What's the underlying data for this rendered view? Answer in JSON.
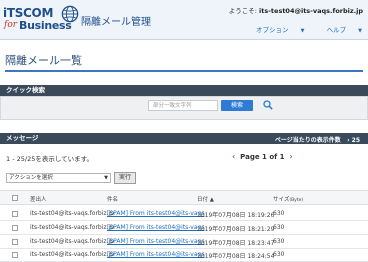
{
  "header": {
    "logo_top": "iTSCOM",
    "logo_for": "for",
    "logo_business": "Business",
    "app_title": "隔離メール管理",
    "welcome_prefix": "ようこそ: ",
    "welcome_user": "its-test04@its-vaqs.forbiz.jp",
    "options_label": "オプション",
    "help_label": "ヘルプ"
  },
  "page": {
    "title": "隔離メール一覧"
  },
  "quick_search": {
    "heading": "クイック検索",
    "placeholder": "部分一致文字列",
    "button_label": "検索"
  },
  "messages_panel": {
    "heading": "メッセージ",
    "page_size_label": "ページ当たりの表示件数",
    "page_size_value": "25"
  },
  "results": {
    "count_text": "1 - 25/25を表示しています。",
    "pager_text": "Page 1 of 1"
  },
  "actions": {
    "selected_action": "アクションを選択",
    "run_label": "実行"
  },
  "table": {
    "headers": {
      "sender": "差出人",
      "subject": "件名",
      "date": "日付",
      "size": "サイズ",
      "size_unit": "(Byte)"
    },
    "rows": [
      {
        "sender": "its-test04@its-vaqs.forbiz.jp",
        "subject": "[SPAM] From its-test04@its-vaqs",
        "date": "2019年07月08日 18:19:26",
        "size": "630"
      },
      {
        "sender": "its-test04@its-vaqs.forbiz.jp",
        "subject": "[SPAM] From its-test04@its-vaqs",
        "date": "2019年07月08日 18:21:29",
        "size": "630"
      },
      {
        "sender": "its-test04@its-vaqs.forbiz.jp",
        "subject": "[SPAM] From its-test04@its-vaqs",
        "date": "2019年07月08日 18:23:47",
        "size": "630"
      },
      {
        "sender": "its-test04@its-vaqs.forbiz.jp",
        "subject": "[SPAM] From its-test04@its-vaqs",
        "date": "2019年07月08日 18:24:54",
        "size": "630"
      }
    ]
  },
  "colors": {
    "brand_blue": "#1f4e8a",
    "accent_blue": "#2e7bd6",
    "panel_dark": "#3b4a5a",
    "link_blue": "#1f6fbf"
  }
}
